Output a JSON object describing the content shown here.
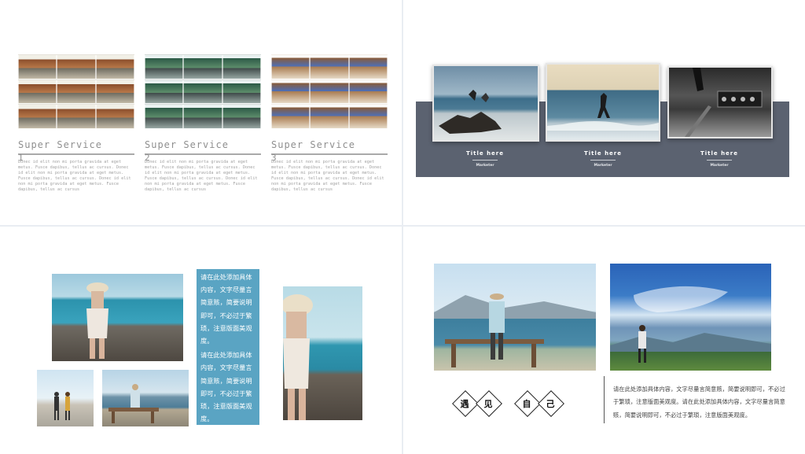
{
  "slide1": {
    "services": [
      {
        "title": "Super Service",
        "number": "1",
        "body": "Donec id elit non mi porta gravida at eget metus. Fusce dapibus, tellus ac cursus. Donec id elit non mi porta gravida at eget metus. Fusce dapibus, tellus ac cursus. Donec id elit non mi porta gravida at eget metus. Fusce dapibus, tellus ac cursus"
      },
      {
        "title": "Super Service",
        "number": "2",
        "body": "Donec id elit non mi porta gravida at eget metus. Fusce dapibus, tellus ac cursus. Donec id elit non mi porta gravida at eget metus. Fusce dapibus, tellus ac cursus. Donec id elit non mi porta gravida at eget metus. Fusce dapibus, tellus ac cursus"
      },
      {
        "title": "Super Service",
        "number": "3",
        "body": "Donec id elit non mi porta gravida at eget metus. Fusce dapibus, tellus ac cursus. Donec id elit non mi porta gravida at eget metus. Fusce dapibus, tellus ac cursus. Donec id elit non mi porta gravida at eget metus. Fusce dapibus, tellus ac cursus"
      }
    ]
  },
  "slide2": {
    "cards": [
      {
        "title": "Title here",
        "subtitle": "Marketer"
      },
      {
        "title": "Title here",
        "subtitle": "Marketer"
      },
      {
        "title": "Title here",
        "subtitle": "Marketer"
      }
    ],
    "band_color": "#5b6270"
  },
  "slide3": {
    "text_box": {
      "para1": "请在此处添加具体内容，文字尽量言简意赅，简要说明即可，不必过于繁琐，注意版面美观度。",
      "para2": "请在此处添加具体内容，文字尽量言简意赅，简要说明即可，不必过于繁琐，注意版面美观度。"
    },
    "accent_color": "#5aa4c3"
  },
  "slide4": {
    "diamonds": [
      "遇",
      "见",
      "自",
      "己"
    ],
    "paragraph": "请在此处添加具体内容，文字尽量言简意赅，简要说明即可，不必过于繁琐，注意版面美观度。请在此处添加具体内容，文字尽量言简意赅，简要说明即可，不必过于繁琐，注意版面美观度。"
  }
}
